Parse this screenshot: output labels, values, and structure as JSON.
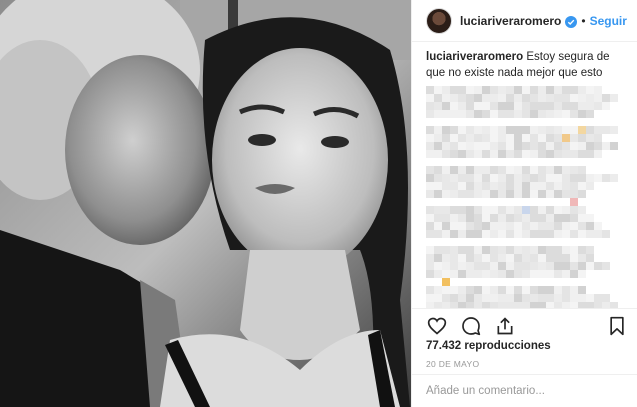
{
  "photo": {
    "description_icon": "photo-image"
  },
  "header": {
    "username": "luciariveraromero",
    "separator": "•",
    "follow_label": "Seguir",
    "verified_icon": "verified-badge-icon"
  },
  "caption": {
    "username": "luciariveraromero",
    "text": "Estoy segura de que no existe nada mejor que esto"
  },
  "actions": {
    "like_icon": "heart-icon",
    "comment_icon": "comment-icon",
    "share_icon": "share-icon",
    "save_icon": "bookmark-icon"
  },
  "stats": {
    "views": "77.432 reproducciones",
    "date": "20 DE MAYO"
  },
  "comment_box": {
    "placeholder": "Añade un comentario..."
  },
  "colors": {
    "link": "#3897f0",
    "text": "#262626",
    "muted": "#999999",
    "border": "#efefef"
  }
}
